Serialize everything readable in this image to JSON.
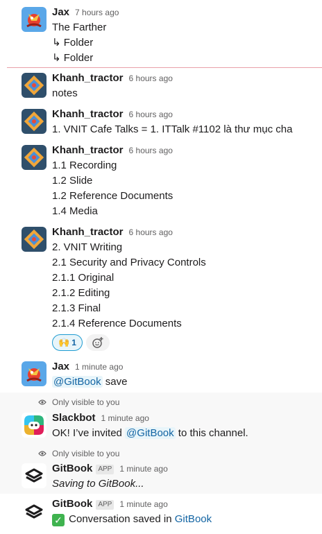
{
  "messages": {
    "m1": {
      "author": "Jax",
      "time": "7 hours ago",
      "lines": [
        "The Farther",
        "↳ Folder",
        "↳ Folder"
      ]
    },
    "m2": {
      "author": "Khanh_tractor",
      "time": "6 hours ago",
      "lines": [
        "notes"
      ]
    },
    "m3": {
      "author": "Khanh_tractor",
      "time": "6 hours ago",
      "lines": [
        "1. VNIT Cafe Talks = 1. ITTalk #1102 là thư mục cha"
      ]
    },
    "m4": {
      "author": "Khanh_tractor",
      "time": "6 hours ago",
      "lines": [
        "1.1 Recording",
        "1.2 Slide",
        "1.2 Reference Documents",
        "1.4 Media"
      ]
    },
    "m5": {
      "author": "Khanh_tractor",
      "time": "6 hours ago",
      "lines": [
        "2. VNIT Writing",
        "2.1 Security and Privacy Controls",
        "2.1.1 Original",
        "2.1.2 Editing",
        "2.1.3 Final",
        "2.1.4 Reference Documents"
      ],
      "reaction_emoji": "🙌",
      "reaction_count": "1",
      "add_reaction_icon": "add-reaction-icon"
    },
    "m6": {
      "author": "Jax",
      "time": "1 minute ago",
      "mention": "@GitBook",
      "text": " save"
    },
    "m7": {
      "visibility": "Only visible to you",
      "author": "Slackbot",
      "time": "1 minute ago",
      "text_before": "OK! I’ve invited ",
      "mention": "@GitBook",
      "text_after": " to this channel."
    },
    "m8": {
      "visibility": "Only visible to you",
      "author": "GitBook",
      "badge": "APP",
      "time": "1 minute ago",
      "text": "Saving to GitBook..."
    },
    "m9": {
      "author": "GitBook",
      "badge": "APP",
      "time": "1 minute ago",
      "check": "✓",
      "text": " Conversation saved in ",
      "link": "GitBook"
    }
  },
  "colors": {
    "mention": "#1264a3",
    "mention_bg": "#e8f5fa",
    "new_divider": "#e8a0a8",
    "ephemeral_bg": "#f8f8f8"
  }
}
